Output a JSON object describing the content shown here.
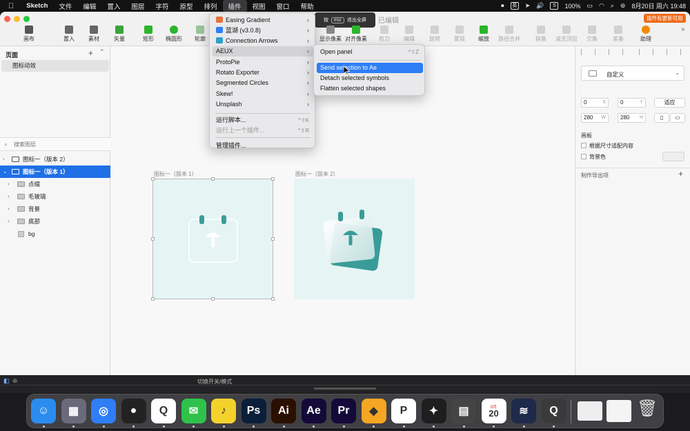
{
  "menubar": {
    "app_name": "Sketch",
    "items": [
      "文件",
      "编辑",
      "置入",
      "图层",
      "字符",
      "原型",
      "排列",
      "插件",
      "视图",
      "窗口",
      "帮助"
    ],
    "active_index": 7,
    "battery": "100%",
    "date_time": "8月20日 周六 19:48",
    "input_label": "英",
    "badge_label": "S"
  },
  "window": {
    "doc_status": "已编辑",
    "update_badge": "插件有更新可用",
    "esc_hint": {
      "prefix": "按",
      "key": "esc",
      "suffix": "退出全屏"
    }
  },
  "toolbar": {
    "items": [
      {
        "label": "画布",
        "color": "#555555",
        "icon": "canvas-icon"
      },
      {
        "label": "置入",
        "color": "#666666",
        "icon": "insert-icon"
      },
      {
        "label": "素材",
        "color": "#666666",
        "icon": "components-icon"
      },
      {
        "label": "矢量",
        "color": "#3aa33a",
        "icon": "vector-icon"
      },
      {
        "label": "矩形",
        "color": "#2bb52b",
        "icon": "rectangle-icon"
      },
      {
        "label": "椭圆形",
        "color": "#2bb52b",
        "icon": "oval-icon"
      },
      {
        "label": "轮廓",
        "color": "#9bc59b",
        "icon": "outline-icon"
      },
      {
        "label": "显示像素",
        "color": "#888888",
        "icon": "pixel-icon"
      },
      {
        "label": "对齐像素",
        "color": "#2bb52b",
        "icon": "pixel-align-icon"
      },
      {
        "label": "剪刀",
        "color": "#aaaaaa",
        "icon": "scissors-icon"
      },
      {
        "label": "编辑",
        "color": "#aaaaaa",
        "icon": "edit-icon"
      },
      {
        "label": "旋转",
        "color": "#aaaaaa",
        "icon": "rotate-icon"
      },
      {
        "label": "蒙版",
        "color": "#aaaaaa",
        "icon": "mask-icon"
      },
      {
        "label": "缩放",
        "color": "#2bb52b",
        "icon": "scale-icon"
      },
      {
        "label": "路径合并",
        "color": "#aaaaaa",
        "icon": "flatten-icon"
      },
      {
        "label": "联集",
        "color": "#aaaaaa",
        "icon": "union-icon"
      },
      {
        "label": "减去顶层",
        "color": "#aaaaaa",
        "icon": "subtract-icon"
      },
      {
        "label": "交集",
        "color": "#aaaaaa",
        "icon": "intersect-icon"
      },
      {
        "label": "差集",
        "color": "#aaaaaa",
        "icon": "difference-icon"
      },
      {
        "label": "助理",
        "color": "#f08a00",
        "icon": "assistant-icon"
      }
    ]
  },
  "left": {
    "pages_header": "页面",
    "page": "图标动效",
    "search_placeholder": "搜索图层",
    "layers": [
      {
        "label": "图标一（版本 2）"
      },
      {
        "label": "图标一（版本 1）"
      },
      {
        "label": "点缀"
      },
      {
        "label": "毛玻璃"
      },
      {
        "label": "背景"
      },
      {
        "label": "底部"
      },
      {
        "label": "bg"
      }
    ]
  },
  "canvas": {
    "artboard1_label": "图标一（版本 1）",
    "artboard2_label": "图标一（版本 2）",
    "artboard_bg": "#e6f4f4",
    "accent": "#3a9c98"
  },
  "right": {
    "preset": "自定义",
    "x": "0",
    "x_unit": "X",
    "y": "0",
    "y_unit": "Y",
    "fit": "适应",
    "w": "280",
    "w_unit": "W",
    "h": "280",
    "h_unit": "H",
    "artboard_section": "画板",
    "resize_content": "根据尺寸适配内容",
    "background_color": "背景色",
    "export_section": "制作导出项"
  },
  "bottom": {
    "label": "切换开关/模式"
  },
  "plugins_menu": {
    "items": [
      {
        "label": "Easing Gradient",
        "arrow": "›",
        "color": "#e8713a"
      },
      {
        "label": "蓝湖 (v3.0.8)",
        "arrow": "›",
        "color": "#2f7ef5"
      },
      {
        "label": "Connection Arrows",
        "arrow": "›",
        "color": "#2fa0c8"
      },
      {
        "label": "AEUX",
        "arrow": "›"
      },
      {
        "label": "ProtoPie",
        "arrow": "›"
      },
      {
        "label": "Rotato Exporter",
        "arrow": "›"
      },
      {
        "label": "Segmented Circles",
        "arrow": "›"
      },
      {
        "label": "Skew!",
        "arrow": "›"
      },
      {
        "label": "Unsplash",
        "arrow": "›"
      },
      {
        "label": "运行脚本...",
        "shortcut": "^⇧K"
      },
      {
        "label": "运行上一个插件...",
        "shortcut": "^⇧R"
      },
      {
        "label": "管理插件..."
      }
    ]
  },
  "aeux_menu": {
    "items": [
      {
        "label": "Open panel",
        "shortcut": "^⇧Z"
      },
      {
        "label": "Send selection to Ae"
      },
      {
        "label": "Detach selected symbols"
      },
      {
        "label": "Flatten selected shapes"
      }
    ]
  },
  "dock": {
    "apps": [
      {
        "name": "finder",
        "glyph": "☺",
        "color": "#2b8cf0"
      },
      {
        "name": "launchpad",
        "glyph": "▦",
        "color": "#6a6a7a"
      },
      {
        "name": "safari",
        "glyph": "◎",
        "color": "#2f7ef5"
      },
      {
        "name": "qq",
        "glyph": "●",
        "color": "#222222"
      },
      {
        "name": "quickq",
        "glyph": "Q",
        "color": "#ffffff"
      },
      {
        "name": "wechat",
        "glyph": "✉",
        "color": "#2fc24a"
      },
      {
        "name": "qqmusic",
        "glyph": "♪",
        "color": "#f5d22b"
      },
      {
        "name": "photoshop",
        "glyph": "Ps",
        "color": "#0b1e3a"
      },
      {
        "name": "illustrator",
        "glyph": "Ai",
        "color": "#2a1000"
      },
      {
        "name": "after-effects",
        "glyph": "Ae",
        "color": "#140a3a"
      },
      {
        "name": "premiere",
        "glyph": "Pr",
        "color": "#140a3a"
      },
      {
        "name": "sketch",
        "glyph": "◆",
        "color": "#f5a623"
      },
      {
        "name": "protopie",
        "glyph": "P",
        "color": "#ffffff"
      },
      {
        "name": "figma",
        "glyph": "✦",
        "color": "#1e1e1e"
      },
      {
        "name": "calculator",
        "glyph": "▤",
        "color": "#444444"
      },
      {
        "name": "calendar",
        "glyph": "20",
        "color": "#ffffff"
      },
      {
        "name": "voice",
        "glyph": "≋",
        "color": "#1e2a4a"
      },
      {
        "name": "quicktime",
        "glyph": "Q",
        "color": "#3a3a3a"
      }
    ],
    "calendar_month": "8月",
    "calendar_day": "20"
  }
}
